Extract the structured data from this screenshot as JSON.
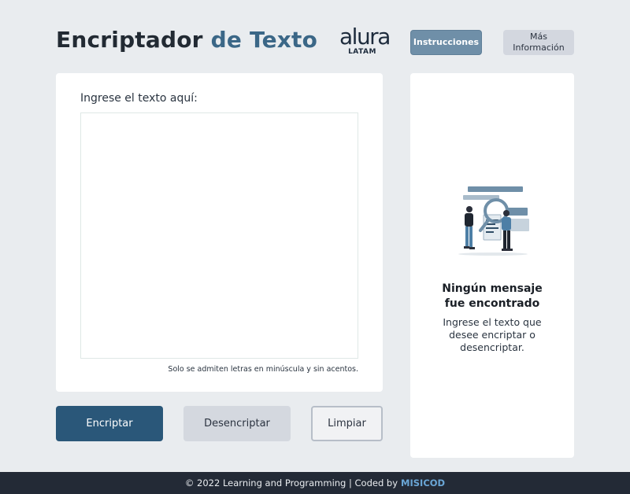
{
  "header": {
    "title_part1": "Encriptador",
    "title_part2": "de Texto",
    "logo_word": "alura",
    "logo_sub": "LATAM",
    "nav_instructions": "Instrucciones",
    "nav_more_info": "Más Información"
  },
  "input_panel": {
    "label": "Ingrese el texto aquí:",
    "value": "",
    "placeholder": "",
    "hint": "Solo se admiten letras en minúscula y sin acentos."
  },
  "actions": {
    "encrypt": "Encriptar",
    "decrypt": "Desencriptar",
    "clear": "Limpiar"
  },
  "output_panel": {
    "title": "Ningún mensaje fue encontrado",
    "body": "Ingrese el texto que desee encriptar o desencriptar."
  },
  "footer": {
    "text": "© 2022 Learning and Programming | Coded by",
    "brand": "MISICOD"
  },
  "colors": {
    "background": "#e9ecef",
    "accent": "#3b6787",
    "primary_button": "#2a5779",
    "footer": "#232a36",
    "footer_brand": "#6aa6d6"
  },
  "icons": [
    "alura-logo",
    "people-search-illustration"
  ]
}
